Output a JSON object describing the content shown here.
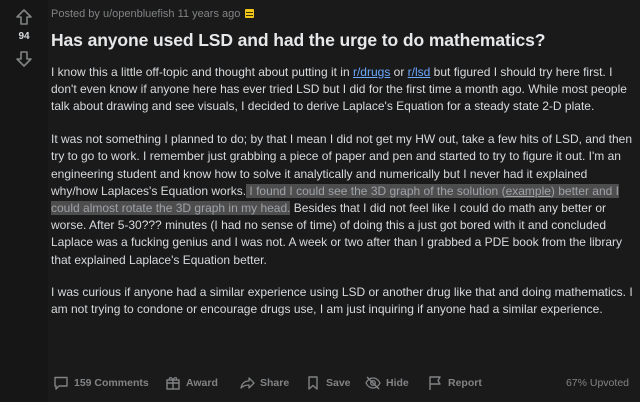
{
  "post": {
    "score": "94",
    "meta": "Posted by u/openbluefish 11 years ago",
    "title": "Has anyone used LSD and had the urge to do mathematics?",
    "p1": {
      "a": "I know this a little off-topic and thought about putting it in ",
      "link1": "r/drugs",
      "b": " or ",
      "link2": "r/lsd",
      "c": " but figured I should try here first. I don't even know if anyone here has ever tried LSD but I did for the first time a month ago. While most people talk about drawing and see visuals, I decided to derive Laplace's Equation for a steady state 2-D plate."
    },
    "p2": {
      "a": "It was not something I planned to do; by that I mean I did not get my HW out, take a few hits of LSD, and then try to go to work. I remember just grabbing a piece of paper and pen and started to try to figure it out. I'm an engineering student and know how to solve it analytically and numerically but I never had it explained why/how Laplaces's Equation works.",
      "hl1": " I found I could see the 3D graph of the solution (",
      "hl_ex": "example",
      "hl2": ") better and I could almost rotate the 3D graph in my head.",
      "b": " Besides that I did not feel like I could do math any better or worse. After 5-30??? minutes (I had no sense of time) of doing this a just got bored with it and concluded Laplace was a fucking genius and I was not. A week or two after than I grabbed a PDE book from the library that explained Laplace's Equation better."
    },
    "p3": "I was curious if anyone had a similar experience using LSD or another drug like that and doing mathematics. I am not trying to condone or encourage drugs use, I am just inquiring if anyone had a similar experience."
  },
  "footer": {
    "comments": "159 Comments",
    "award": "Award",
    "share": "Share",
    "save": "Save",
    "hide": "Hide",
    "report": "Report",
    "upvoted": "67% Upvoted"
  }
}
